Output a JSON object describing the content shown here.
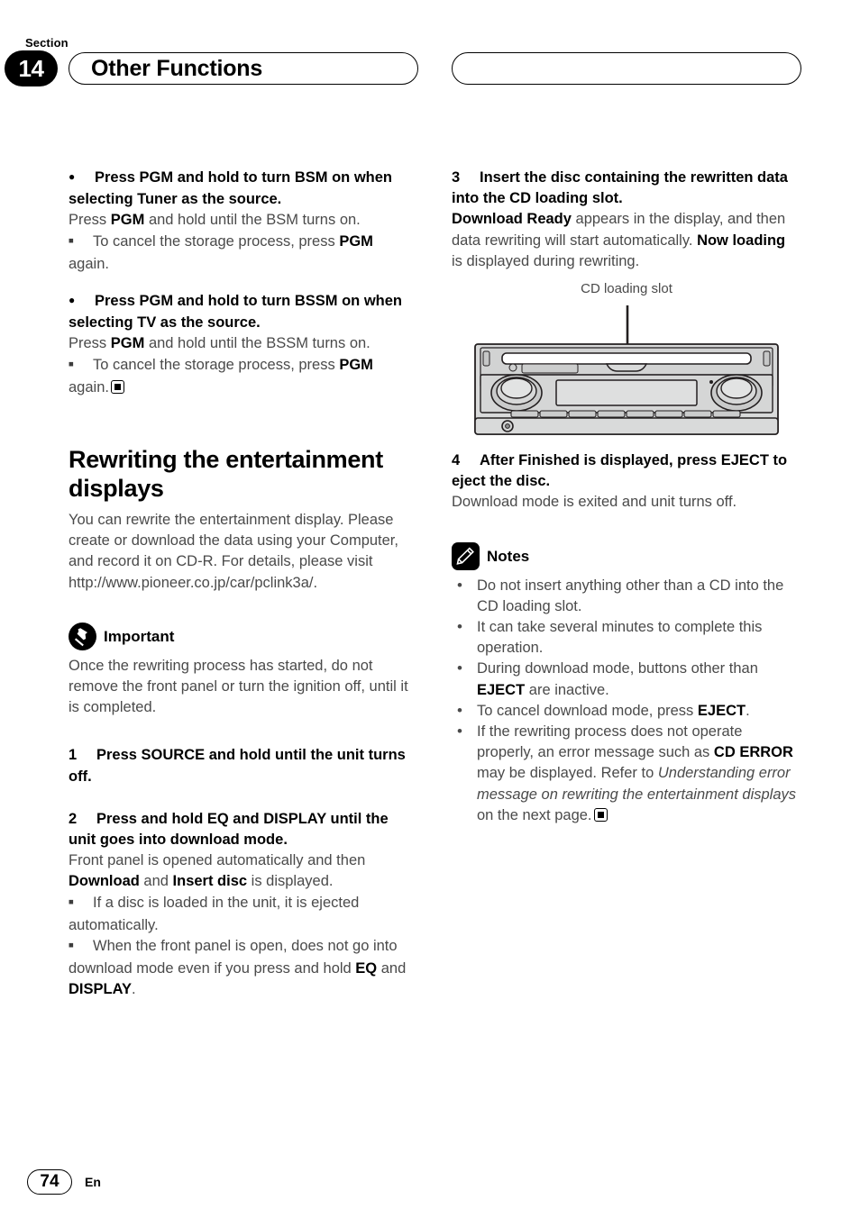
{
  "header": {
    "section_label": "Section",
    "section_number": "14",
    "title": "Other Functions",
    "right_pill_title": ""
  },
  "left_column": {
    "bullet1": {
      "marker": "●",
      "heading": "Press PGM and hold to turn BSM on when selecting Tuner as the source.",
      "body_pre": "Press ",
      "body_bold": "PGM",
      "body_post": " and hold until the BSM turns on.",
      "sub_pre": "To cancel the storage process, press ",
      "sub_bold": "PGM",
      "sub_post": " again."
    },
    "bullet2": {
      "marker": "●",
      "heading": "Press PGM and hold to turn BSSM on when selecting TV as the source.",
      "body_pre": "Press ",
      "body_bold": "PGM",
      "body_post": " and hold until the BSSM turns on.",
      "sub_pre": "To cancel the storage process, press ",
      "sub_bold": "PGM",
      "sub_post": " again."
    },
    "section_heading": "Rewriting the entertainment displays",
    "section_body": "You can rewrite the entertainment display. Please create or download the data using your Computer, and record it on CD-R. For details, please visit http://www.pioneer.co.jp/car/pclink3a/.",
    "important": {
      "icon": "pushpin-icon",
      "label": "Important",
      "body": "Once the rewriting process has started, do not remove the front panel or turn the ignition off, until it is completed."
    },
    "step1": {
      "number": "1",
      "heading": "Press SOURCE and hold until the unit turns off."
    },
    "step2": {
      "number": "2",
      "heading": "Press and hold EQ and DISPLAY until the unit goes into download mode.",
      "body_pre": "Front panel is opened automatically and then ",
      "body_b1": "Download",
      "body_mid": " and ",
      "body_b2": "Insert disc",
      "body_post": " is displayed.",
      "sub1": "If a disc is loaded in the unit, it is ejected automatically.",
      "sub2_pre": "When the front panel is open, does not go into download mode even if you press and hold ",
      "sub2_b1": "EQ",
      "sub2_mid": " and ",
      "sub2_b2": "DISPLAY",
      "sub2_post": "."
    }
  },
  "right_column": {
    "step3": {
      "number": "3",
      "heading": "Insert the disc containing the rewritten data into the CD loading slot.",
      "body_b1": "Download Ready",
      "body_1": " appears in the display, and then data rewriting will start automatically.",
      "body_b2": "Now loading",
      "body_2": " is displayed during rewriting."
    },
    "figure": {
      "caption": "CD loading slot",
      "name": "car-stereo-head-unit-diagram"
    },
    "step4": {
      "number": "4",
      "heading": "After Finished is displayed, press EJECT to eject the disc.",
      "body": "Download mode is exited and unit turns off."
    },
    "notes": {
      "icon": "pencil-icon",
      "label": "Notes",
      "items": [
        {
          "text": "Do not insert anything other than a CD into the CD loading slot."
        },
        {
          "text": "It can take several minutes to complete this operation."
        },
        {
          "pre": "During download mode, buttons other than ",
          "bold": "EJECT",
          "post": " are inactive."
        },
        {
          "pre": "To cancel download mode, press ",
          "bold": "EJECT",
          "post": "."
        },
        {
          "pre": "If the rewriting process does not operate properly, an error message such as ",
          "bold": "CD ERROR",
          "mid": " may be displayed. Refer to ",
          "italic": "Understanding error message on rewriting the entertainment displays",
          "post": " on the next page."
        }
      ]
    }
  },
  "footer": {
    "page_number": "74",
    "language": "En"
  }
}
